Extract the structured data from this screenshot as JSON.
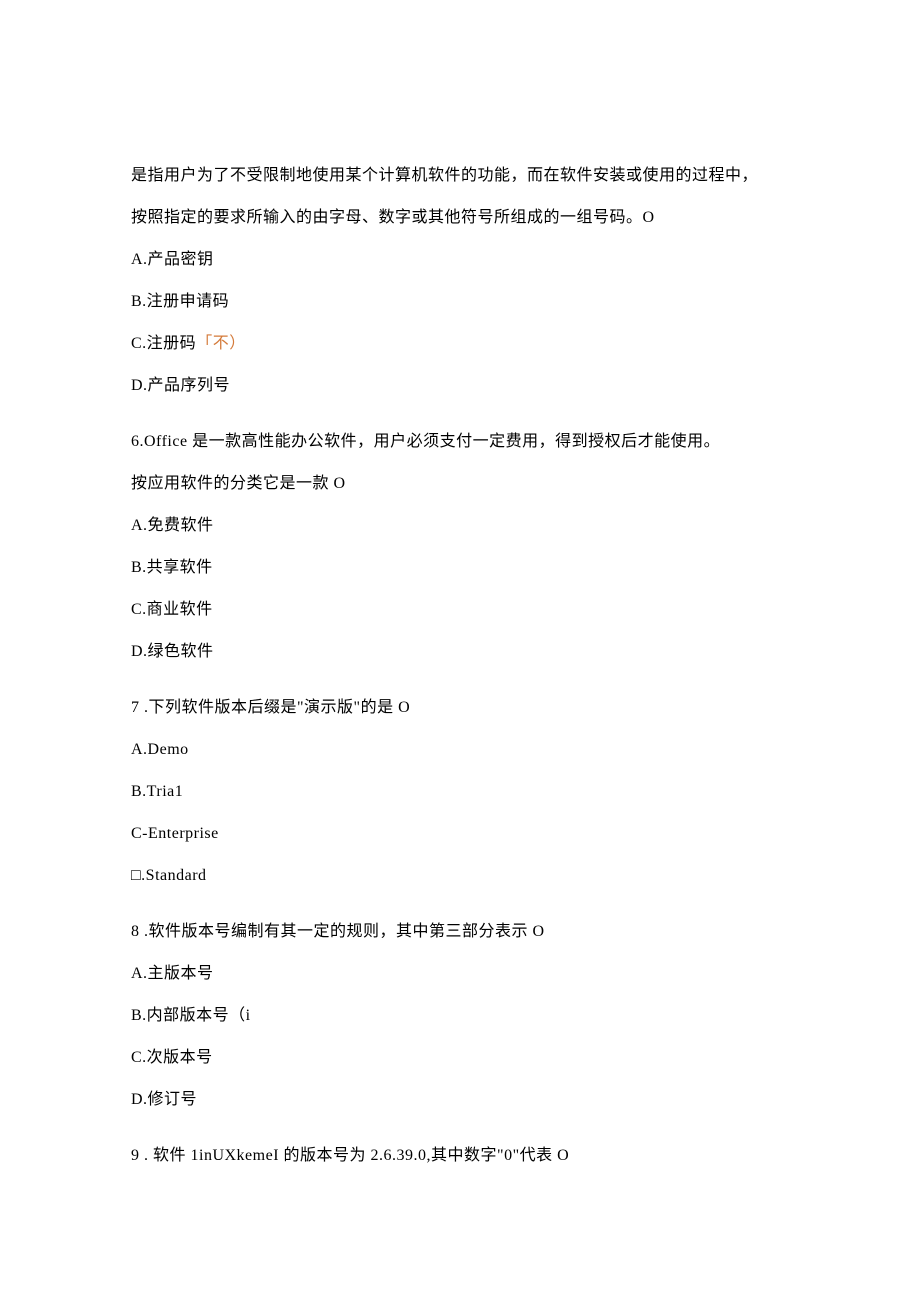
{
  "q5": {
    "stem_line1": "是指用户为了不受限制地使用某个计算机软件的功能，而在软件安装或使用的过程中，",
    "stem_line2": "按照指定的要求所输入的由字母、数字或其他符号所组成的一组号码。O",
    "optA": "A.产品密钥",
    "optB": "B.注册申请码",
    "optC_text": "C.注册码",
    "optC_mark": "「不）",
    "optD": "D.产品序列号"
  },
  "q6": {
    "stem_line1": "6.Office 是一款高性能办公软件，用户必须支付一定费用，得到授权后才能使用。",
    "stem_line2": "按应用软件的分类它是一款 O",
    "optA": "A.免费软件",
    "optB": "B.共享软件",
    "optC": "C.商业软件",
    "optD": "D.绿色软件"
  },
  "q7": {
    "stem": "7   .下列软件版本后缀是\"演示版\"的是 O",
    "optA": "A.Demo",
    "optB": "B.Tria1",
    "optC": "C-Enterprise",
    "optD": "□.Standard"
  },
  "q8": {
    "stem": "8   .软件版本号编制有其一定的规则，其中第三部分表示 O",
    "optA": "A.主版本号",
    "optB": "B.内部版本号（i",
    "optC": "C.次版本号",
    "optD": "D.修订号"
  },
  "q9": {
    "stem": "9   . 软件 1inUXkemeI 的版本号为 2.6.39.0,其中数字\"0\"代表 O"
  }
}
